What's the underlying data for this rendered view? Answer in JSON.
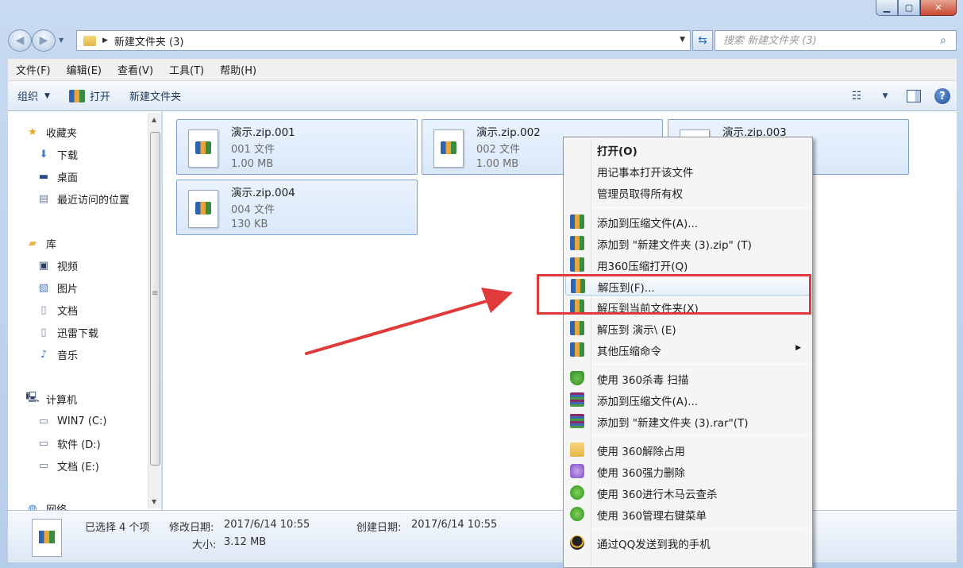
{
  "window": {
    "address_path": "新建文件夹 (3)",
    "search_placeholder": "搜索 新建文件夹 (3)"
  },
  "menubar": [
    "文件(F)",
    "编辑(E)",
    "查看(V)",
    "工具(T)",
    "帮助(H)"
  ],
  "toolbar": {
    "organize": "组织",
    "open": "打开",
    "new_folder": "新建文件夹"
  },
  "navpane": {
    "favorites": "收藏夹",
    "fav_items": [
      "下载",
      "桌面",
      "最近访问的位置"
    ],
    "libraries": "库",
    "lib_items": [
      "视频",
      "图片",
      "文档",
      "迅雷下载",
      "音乐"
    ],
    "computer": "计算机",
    "drives": [
      "WIN7 (C:)",
      "软件 (D:)",
      "文档 (E:)"
    ],
    "network": "网络"
  },
  "files": [
    {
      "name": "演示.zip.001",
      "type": "001 文件",
      "size": "1.00 MB"
    },
    {
      "name": "演示.zip.002",
      "type": "002 文件",
      "size": "1.00 MB"
    },
    {
      "name": "演示.zip.003",
      "type": "",
      "size": ""
    },
    {
      "name": "演示.zip.004",
      "type": "004 文件",
      "size": "130 KB"
    }
  ],
  "statusbar": {
    "selected": "已选择 4 个项",
    "modified_label": "修改日期:",
    "modified_value": "2017/6/14 10:55",
    "created_label": "创建日期:",
    "created_value": "2017/6/14 10:55",
    "size_label": "大小:",
    "size_value": "3.12 MB"
  },
  "context_menu": {
    "items": [
      {
        "label": "打开(O)",
        "icon": "none"
      },
      {
        "label": "用记事本打开该文件",
        "icon": "none"
      },
      {
        "label": "管理员取得所有权",
        "icon": "none"
      },
      {
        "label": "添加到压缩文件(A)...",
        "icon": "zip-icon"
      },
      {
        "label": "添加到 \"新建文件夹 (3).zip\" (T)",
        "icon": "zip-icon"
      },
      {
        "label": "用360压缩打开(Q)",
        "icon": "zip-icon"
      },
      {
        "label": "解压到(F)...",
        "icon": "zip-icon"
      },
      {
        "label": "解压到当前文件夹(X)",
        "icon": "zip-icon"
      },
      {
        "label": "解压到 演示\\ (E)",
        "icon": "zip-icon"
      },
      {
        "label": "其他压缩命令",
        "icon": "zip-icon"
      },
      {
        "label": "使用 360杀毒 扫描",
        "icon": "shield-icon"
      },
      {
        "label": "添加到压缩文件(A)...",
        "icon": "rar-icon"
      },
      {
        "label": "添加到 \"新建文件夹 (3).rar\"(T)",
        "icon": "rar-icon"
      },
      {
        "label": "使用 360解除占用",
        "icon": "folder-icon"
      },
      {
        "label": "使用 360强力删除",
        "icon": "purple-icon"
      },
      {
        "label": "使用 360进行木马云查杀",
        "icon": "green-plus-icon"
      },
      {
        "label": "使用 360管理右键菜单",
        "icon": "green-plus-icon"
      },
      {
        "label": "通过QQ发送到我的手机",
        "icon": "qq-icon"
      }
    ]
  },
  "colors": {
    "highlight_box": "#e03a3a",
    "selection_tile": "#d9e8fa"
  }
}
